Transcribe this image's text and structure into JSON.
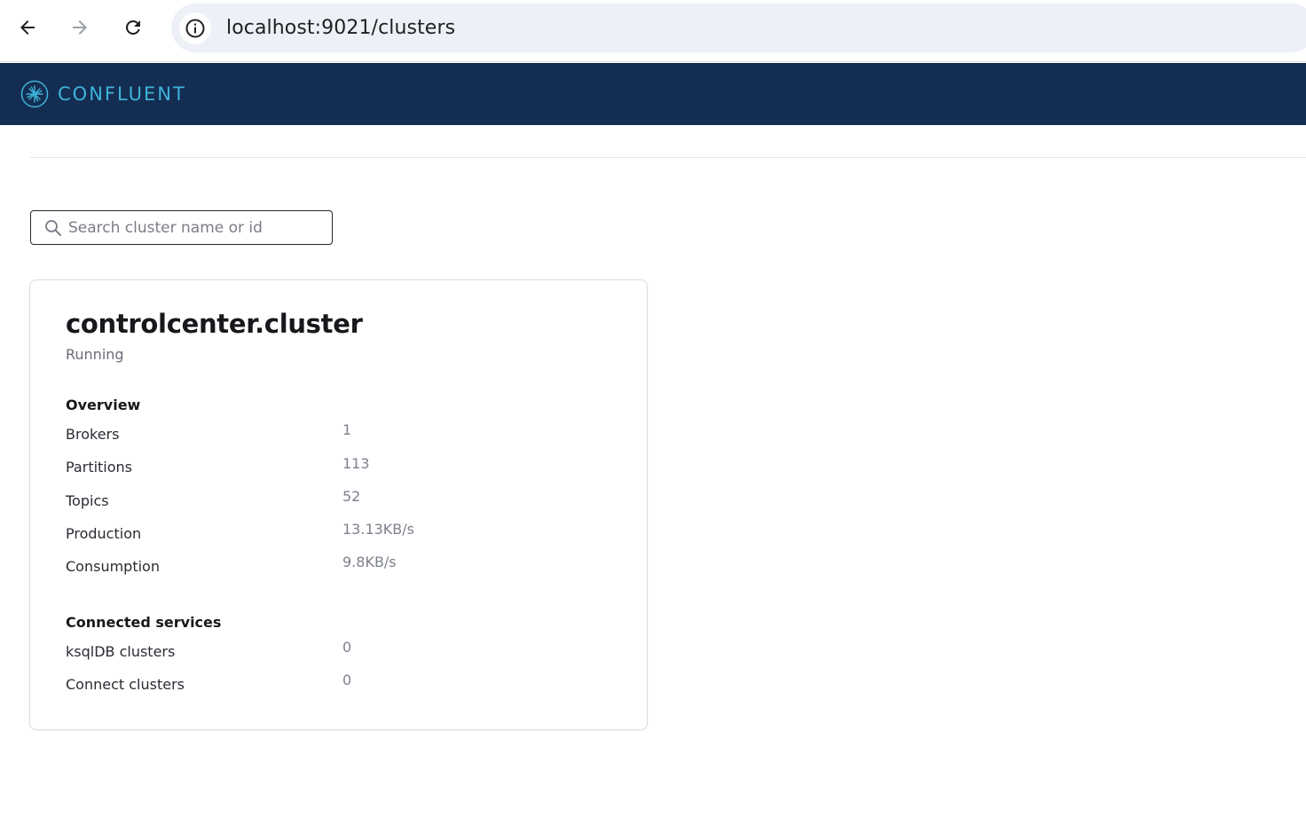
{
  "browser": {
    "url": "localhost:9021/clusters"
  },
  "header": {
    "brand": "CONFLUENT"
  },
  "search": {
    "placeholder": "Search cluster name or id",
    "value": ""
  },
  "cluster": {
    "name": "controlcenter.cluster",
    "status": "Running",
    "overview": {
      "heading": "Overview",
      "rows": [
        {
          "label": "Brokers",
          "value": "1"
        },
        {
          "label": "Partitions",
          "value": "113"
        },
        {
          "label": "Topics",
          "value": "52"
        },
        {
          "label": "Production",
          "value": "13.13KB/s"
        },
        {
          "label": "Consumption",
          "value": "9.8KB/s"
        }
      ]
    },
    "services": {
      "heading": "Connected services",
      "rows": [
        {
          "label": "ksqlDB clusters",
          "value": "0"
        },
        {
          "label": "Connect clusters",
          "value": "0"
        }
      ]
    }
  },
  "colors": {
    "header_bg": "#142d52",
    "brand_accent": "#3fb3d9"
  }
}
